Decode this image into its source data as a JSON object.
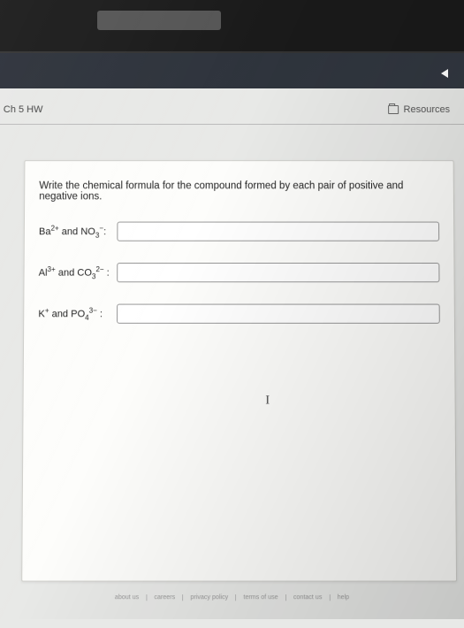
{
  "header": {
    "assignment_title": "Ch 5 HW",
    "resources_label": "Resources"
  },
  "question": {
    "prompt": "Write the chemical formula for the compound formed by each pair of positive and negative ions."
  },
  "rows": [
    {
      "cation": "Ba",
      "cation_charge": "2+",
      "anion": "NO",
      "anion_sub": "3",
      "anion_charge": "−",
      "value": ""
    },
    {
      "cation": "Al",
      "cation_charge": "3+",
      "anion": "CO",
      "anion_sub": "3",
      "anion_charge": "2−",
      "value": ""
    },
    {
      "cation": "K",
      "cation_charge": "+",
      "anion": "PO",
      "anion_sub": "4",
      "anion_charge": "3−",
      "value": ""
    }
  ],
  "footer": {
    "links": [
      "about us",
      "careers",
      "privacy policy",
      "terms of use",
      "contact us",
      "help"
    ]
  }
}
